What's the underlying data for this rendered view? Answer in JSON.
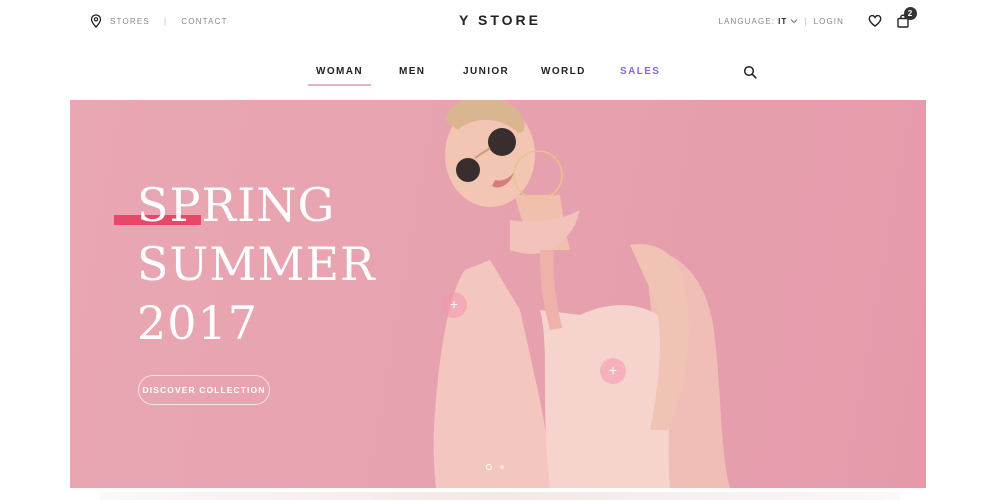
{
  "header": {
    "brand": "Y STORE",
    "stores_label": "STORES",
    "contact_label": "CONTACT",
    "separator": "|",
    "language_label": "LANGUAGE:",
    "language_value": "IT",
    "login_label": "LOGIN",
    "cart_count": "2"
  },
  "nav": {
    "items": [
      {
        "label": "WOMAN"
      },
      {
        "label": "MEN"
      },
      {
        "label": "JUNIOR"
      },
      {
        "label": "WORLD"
      },
      {
        "label": "SALES"
      }
    ],
    "active": "WOMAN"
  },
  "hero": {
    "title_line1": "SPRING",
    "title_line2": "SUMMER",
    "title_line3": "2017",
    "cta_label": "DISCOVER COLLECTION",
    "hotspot_symbol": "+",
    "slides": 2,
    "active_slide": 1
  },
  "colors": {
    "hero_bg": "#e9a7b3",
    "accent_bar": "#e8476a",
    "sales": "#8a67d6",
    "nav_underline": "#e7b3c2"
  }
}
